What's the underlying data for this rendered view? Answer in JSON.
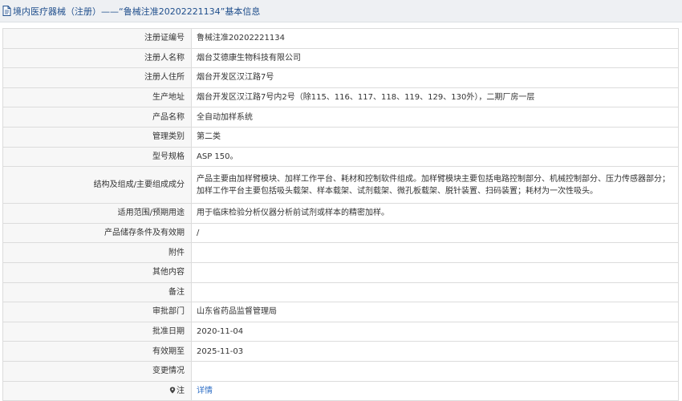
{
  "header": {
    "title": "境内医疗器械（注册）——“鲁械注准20202221134”基本信息"
  },
  "rows": [
    {
      "label": "注册证编号",
      "value": "鲁械注准20202221134"
    },
    {
      "label": "注册人名称",
      "value": "烟台艾德康生物科技有限公司"
    },
    {
      "label": "注册人住所",
      "value": "烟台开发区汉江路7号"
    },
    {
      "label": "生产地址",
      "value": "烟台开发区汉江路7号内2号（除115、116、117、118、119、129、130外），二期厂房一层"
    },
    {
      "label": "产品名称",
      "value": "全自动加样系统"
    },
    {
      "label": "管理类别",
      "value": "第二类"
    },
    {
      "label": "型号规格",
      "value": "ASP 150。"
    },
    {
      "label": "结构及组成/主要组成成分",
      "value": "产品主要由加样臂模块、加样工作平台、耗材和控制软件组成。加样臂模块主要包括电路控制部分、机械控制部分、压力传感器部分；加样工作平台主要包括吸头载架、样本载架、试剂载架、微孔板载架、脱针装置、扫码装置；耗材为一次性吸头。"
    },
    {
      "label": "适用范围/预期用途",
      "value": "用于临床检验分析仪器分析前试剂或样本的精密加样。"
    },
    {
      "label": "产品储存条件及有效期",
      "value": "/"
    },
    {
      "label": "附件",
      "value": ""
    },
    {
      "label": "其他内容",
      "value": ""
    },
    {
      "label": "备注",
      "value": ""
    },
    {
      "label": "审批部门",
      "value": "山东省药品监督管理局"
    },
    {
      "label": "批准日期",
      "value": "2020-11-04"
    },
    {
      "label": "有效期至",
      "value": "2025-11-03"
    },
    {
      "label": "变更情况",
      "value": ""
    },
    {
      "label": "注",
      "value": "详情",
      "icon": "location-pin-icon"
    }
  ]
}
